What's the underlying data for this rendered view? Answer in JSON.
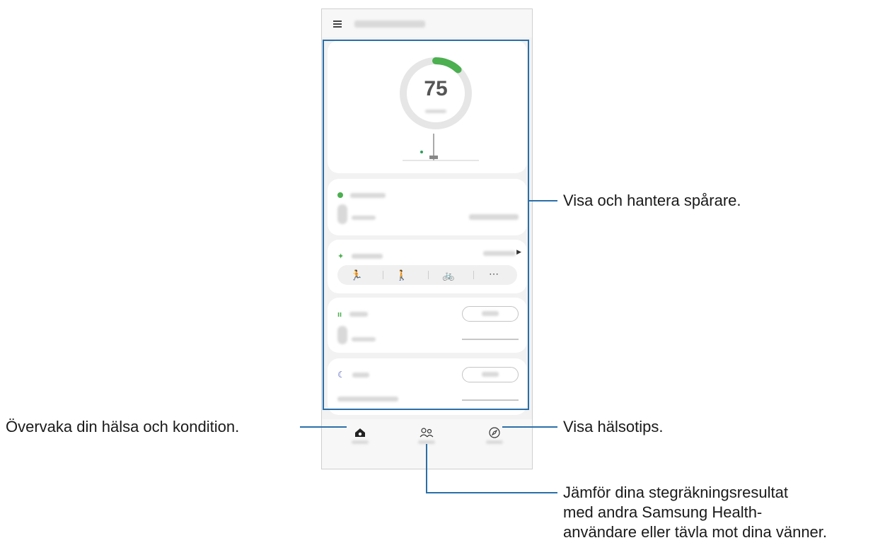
{
  "app": {
    "menu_icon": "hamburger-menu-icon"
  },
  "summary": {
    "score": "75",
    "progress": 0.12,
    "accent_color": "#4caf50"
  },
  "trackers": [
    {
      "icon": "activity-icon",
      "color": "#4caf50"
    },
    {
      "icon": "exercise-run-icon",
      "color": "#4caf50"
    },
    {
      "icon": "food-utensils-icon",
      "color": "#4caf50"
    },
    {
      "icon": "sleep-moon-icon",
      "color": "#3f51b5"
    }
  ],
  "exercise_icons": [
    "running-icon",
    "walking-icon",
    "cycling-icon",
    "more-options-icon"
  ],
  "bottom_nav": [
    {
      "icon": "home-icon"
    },
    {
      "icon": "together-people-icon"
    },
    {
      "icon": "discover-compass-icon"
    }
  ],
  "callouts": {
    "trackers": "Visa och hantera spårare.",
    "home": "Övervaka din hälsa och kondition.",
    "discover": "Visa hälsotips.",
    "together_line1": "Jämför dina stegräkningsresultat",
    "together_line2": "med andra Samsung Health-",
    "together_line3": "användare eller tävla mot dina vänner."
  },
  "colors": {
    "callout_line": "#2a6fa8",
    "home_active": "#222222"
  }
}
